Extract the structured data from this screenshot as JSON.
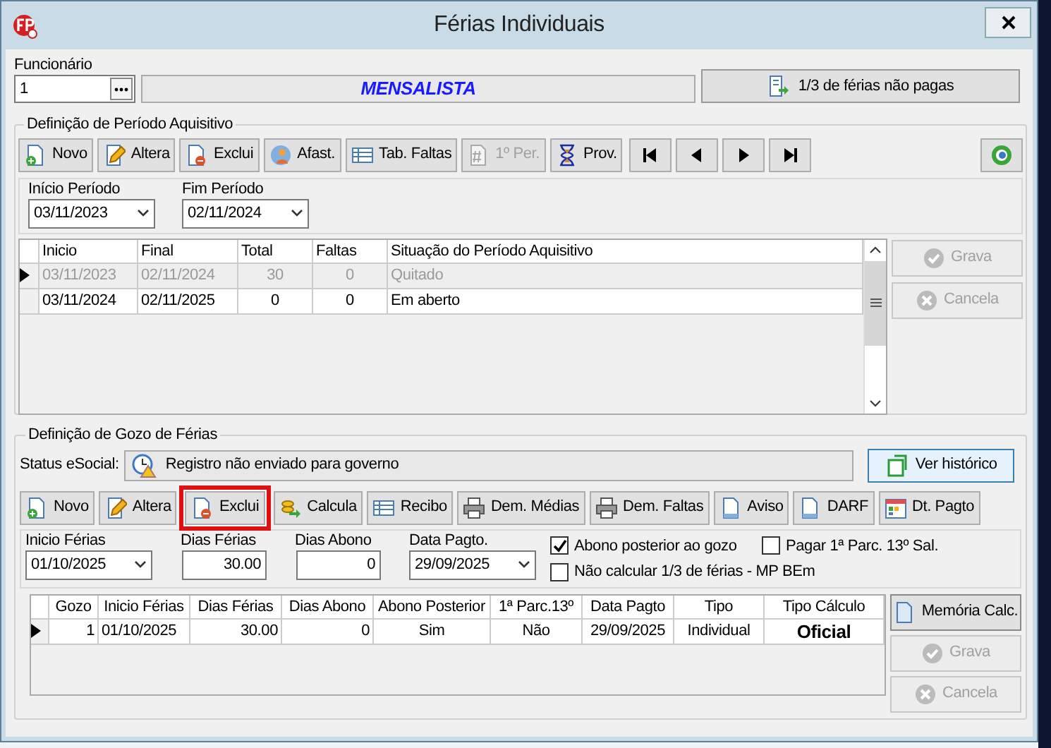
{
  "window": {
    "title": "Férias Individuais"
  },
  "employee": {
    "label": "Funcionário",
    "value": "1",
    "name": "MENSALISTA",
    "button": "1/3 de férias não pagas"
  },
  "period": {
    "title": "Definição de Período Aquisitivo",
    "toolbar": [
      {
        "kind": "new",
        "label": "Novo",
        "disabled": false
      },
      {
        "kind": "edit",
        "label": "Altera",
        "disabled": false
      },
      {
        "kind": "delete",
        "label": "Exclui",
        "disabled": false
      },
      {
        "kind": "person",
        "label": "Afast.",
        "disabled": false
      },
      {
        "kind": "table",
        "label": "Tab. Faltas",
        "disabled": false
      },
      {
        "kind": "hash",
        "label": "1º Per.",
        "disabled": true
      },
      {
        "kind": "hourglass",
        "label": "Prov.",
        "disabled": false
      },
      {
        "kind": "first"
      },
      {
        "kind": "prev"
      },
      {
        "kind": "next"
      },
      {
        "kind": "last"
      }
    ],
    "start": {
      "label": "Início Período",
      "value": "03/11/2023"
    },
    "end": {
      "label": "Fim Período",
      "value": "02/11/2024"
    },
    "columns": [
      "Inicio",
      "Final",
      "Total",
      "Faltas",
      "Situação do Período Aquisitivo"
    ],
    "rows": [
      {
        "selected": true,
        "greyed": true,
        "cells": [
          "03/11/2023",
          "02/11/2024",
          "30",
          "0",
          "Quitado"
        ]
      },
      {
        "selected": false,
        "greyed": false,
        "cells": [
          "03/11/2024",
          "02/11/2025",
          "0",
          "0",
          "Em aberto"
        ]
      }
    ],
    "actions": [
      {
        "kind": "save",
        "label": "Grava",
        "disabled": true
      },
      {
        "kind": "cancel",
        "label": "Cancela",
        "disabled": true
      }
    ]
  },
  "gozo": {
    "title": "Definição de Gozo de Férias",
    "status_label": "Status eSocial:",
    "status": "Registro não enviado para governo",
    "history_button": "Ver histórico",
    "toolbar": [
      {
        "kind": "new",
        "label": "Novo",
        "highlighted": false
      },
      {
        "kind": "edit",
        "label": "Altera",
        "highlighted": false
      },
      {
        "kind": "delete",
        "label": "Exclui",
        "highlighted": true
      },
      {
        "kind": "calc",
        "label": "Calcula",
        "highlighted": false
      },
      {
        "kind": "table",
        "label": "Recibo",
        "highlighted": false
      },
      {
        "kind": "print",
        "label": "Dem. Médias",
        "highlighted": false
      },
      {
        "kind": "print",
        "label": "Dem. Faltas",
        "highlighted": false
      },
      {
        "kind": "doc",
        "label": "Aviso",
        "highlighted": false
      },
      {
        "kind": "doc",
        "label": "DARF",
        "highlighted": false
      },
      {
        "kind": "calendar",
        "label": "Dt. Pagto",
        "highlighted": false
      }
    ],
    "fields": [
      {
        "kind": "date",
        "label": "Inicio Férias",
        "value": "01/10/2025"
      },
      {
        "kind": "number",
        "label": "Dias Férias",
        "value": "30.00"
      },
      {
        "kind": "number",
        "label": "Dias Abono",
        "value": "0"
      },
      {
        "kind": "date",
        "label": "Data Pagto.",
        "value": "29/09/2025"
      }
    ],
    "checks": [
      {
        "label": "Abono posterior ao gozo",
        "checked": true
      },
      {
        "label": "Pagar 1ª Parc. 13º Sal.",
        "checked": false
      },
      {
        "label": "Não calcular 1/3 de férias - MP BEm",
        "checked": false
      }
    ],
    "columns": [
      "Gozo",
      "Inicio Férias",
      "Dias Férias",
      "Dias Abono",
      "Abono Posterior",
      "1ª Parc.13º",
      "Data Pagto",
      "Tipo",
      "Tipo Cálculo"
    ],
    "rows": [
      {
        "selected": true,
        "cells": [
          "1",
          "01/10/2025",
          "30.00",
          "0",
          "Sim",
          "Não",
          "29/09/2025",
          "Individual",
          "Oficial"
        ]
      }
    ],
    "actions": [
      {
        "kind": "memo",
        "label": "Memória Calc.",
        "disabled": false
      },
      {
        "kind": "save",
        "label": "Grava",
        "disabled": true
      },
      {
        "kind": "cancel",
        "label": "Cancela",
        "disabled": true
      }
    ]
  }
}
